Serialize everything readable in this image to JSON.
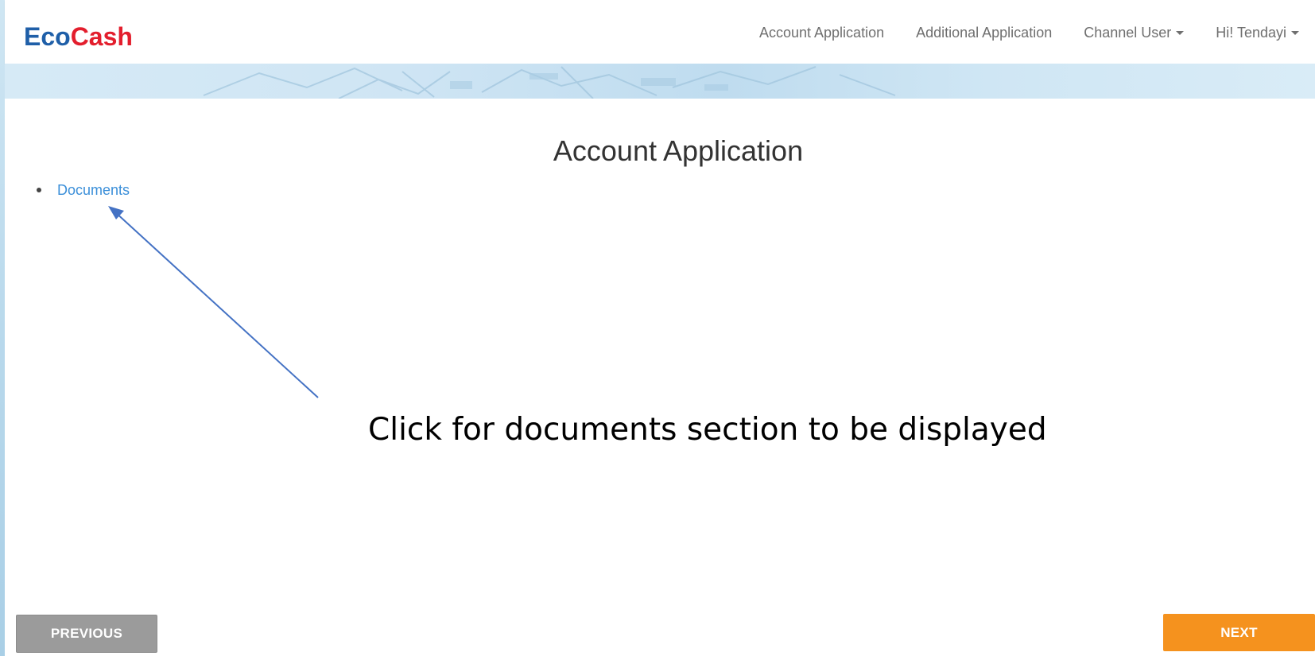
{
  "brand": {
    "part1": "Eco",
    "part2": "Cash",
    "color1": "#1f5fa8",
    "color2": "#e31e2d"
  },
  "nav": {
    "items": [
      {
        "label": "Account Application",
        "dropdown": false
      },
      {
        "label": "Additional Application",
        "dropdown": false
      },
      {
        "label": "Channel User",
        "dropdown": true
      },
      {
        "label": "Hi! Tendayi",
        "dropdown": true
      }
    ]
  },
  "main": {
    "title": "Account Application",
    "links": [
      {
        "label": "Documents"
      }
    ],
    "annotation": "Click for documents section to be displayed"
  },
  "buttons": {
    "previous": "PREVIOUS",
    "next": "NEXT",
    "next_color": "#f5921e",
    "previous_color": "#9b9b9b"
  },
  "colors": {
    "link": "#3b8fd9",
    "arrow": "#4472c4"
  }
}
